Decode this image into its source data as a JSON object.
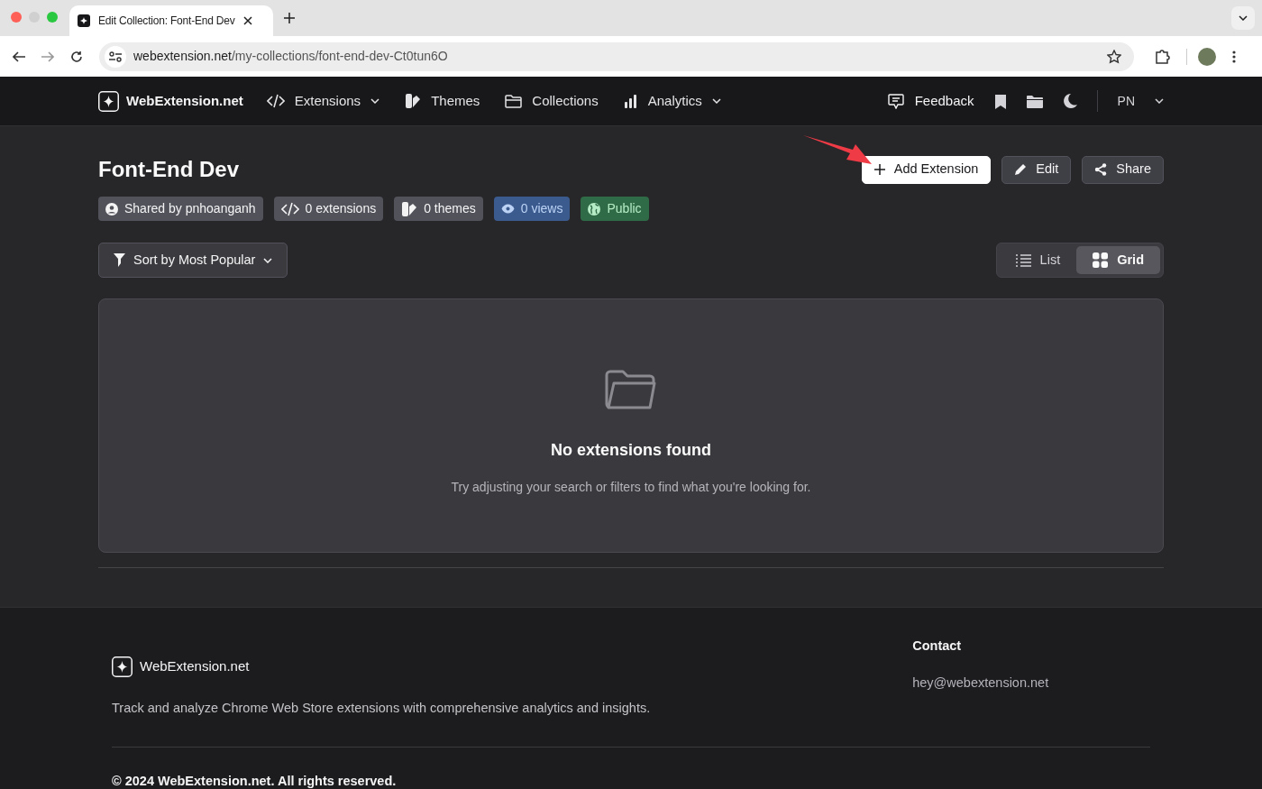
{
  "browser": {
    "tab_title": "Edit Collection: Font-End Dev",
    "url_host": "webextension.net",
    "url_path": "/my-collections/font-end-dev-Ct0tun6O"
  },
  "nav": {
    "brand": "WebExtension.net",
    "items": [
      {
        "label": "Extensions",
        "kind": "code",
        "dropdown": true
      },
      {
        "label": "Themes",
        "kind": "theme",
        "dropdown": false
      },
      {
        "label": "Collections",
        "kind": "folder",
        "dropdown": false
      },
      {
        "label": "Analytics",
        "kind": "chart",
        "dropdown": true
      }
    ],
    "feedback": "Feedback",
    "user_initials": "PN"
  },
  "page": {
    "title": "Font-End Dev",
    "actions": [
      {
        "label": "Add Extension",
        "kind": "primary"
      },
      {
        "label": "Edit",
        "kind": "edit"
      },
      {
        "label": "Share",
        "kind": "share"
      }
    ],
    "badges": [
      {
        "label": "Shared by pnhoanganh",
        "kind": "user"
      },
      {
        "label": "0 extensions",
        "kind": "code"
      },
      {
        "label": "0 themes",
        "kind": "theme"
      },
      {
        "label": "0 views",
        "kind": "views"
      },
      {
        "label": "Public",
        "kind": "public"
      }
    ],
    "sort": "Sort by Most Popular",
    "views": [
      {
        "label": "List",
        "kind": "list",
        "selected": false
      },
      {
        "label": "Grid",
        "kind": "grid",
        "selected": true
      }
    ],
    "empty": {
      "title": "No extensions found",
      "message": "Try adjusting your search or filters to find what you're looking for."
    }
  },
  "footer": {
    "brand": "WebExtension.net",
    "tagline": "Track and analyze Chrome Web Store extensions with comprehensive analytics and insights.",
    "contact_heading": "Contact",
    "email": "hey@webextension.net",
    "copyright": "© 2024 WebExtension.net. All rights reserved."
  }
}
